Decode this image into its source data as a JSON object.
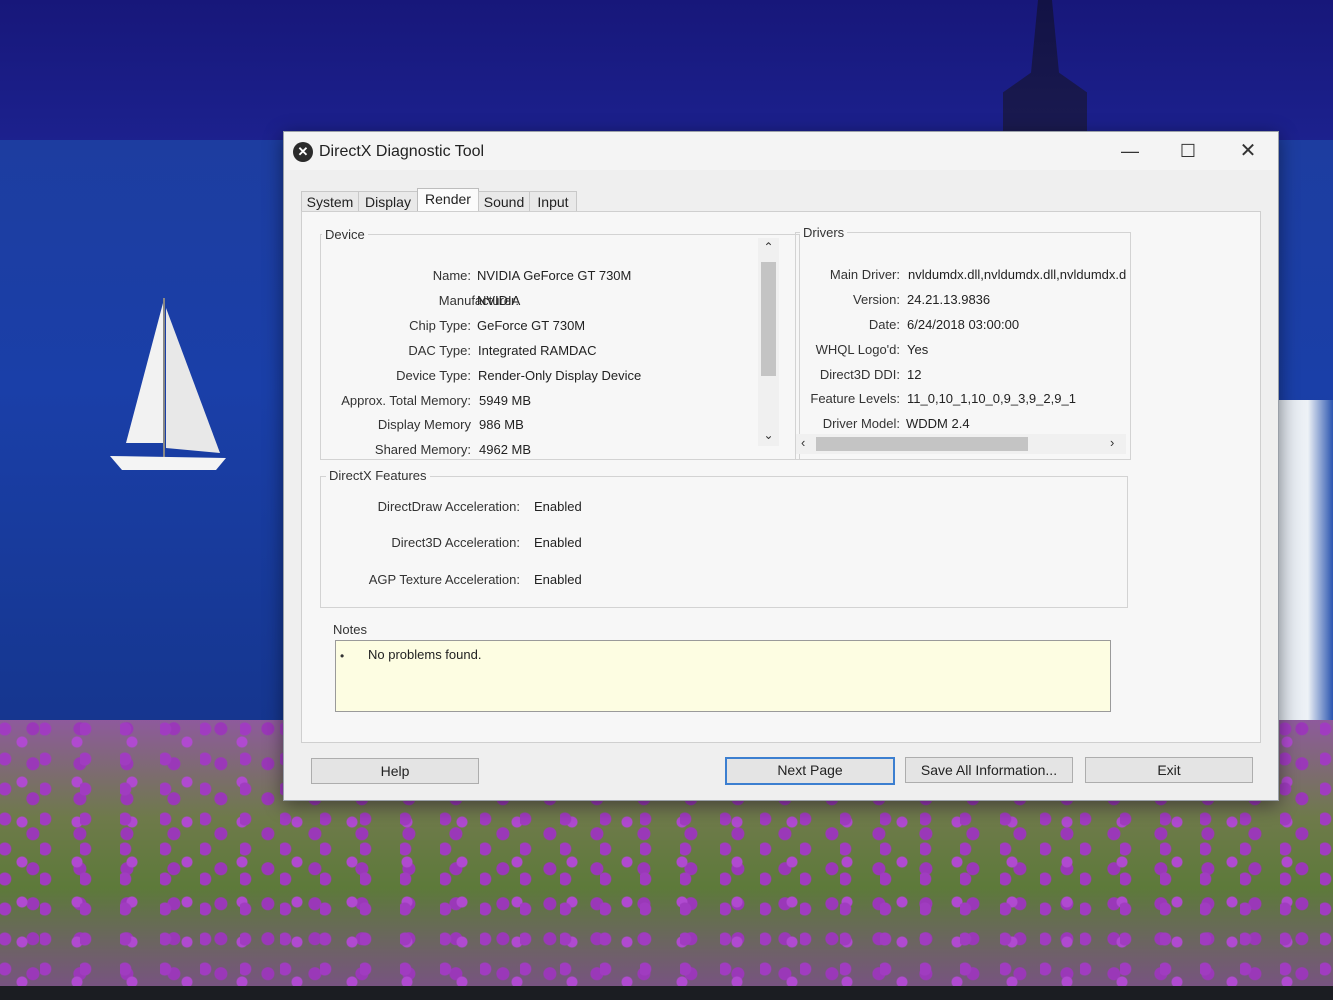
{
  "window": {
    "title": "DirectX Diagnostic Tool",
    "icon": "directx-icon",
    "controls": [
      "minimize-icon",
      "maximize-icon",
      "close-icon"
    ]
  },
  "tabs": [
    {
      "label": "System"
    },
    {
      "label": "Display"
    },
    {
      "label": "Render",
      "active": true
    },
    {
      "label": "Sound"
    },
    {
      "label": "Input"
    }
  ],
  "device": {
    "title": "Device",
    "rows": [
      {
        "label": "Name:",
        "value": "NVIDIA GeForce GT 730M"
      },
      {
        "label": "Manufacturer:",
        "value": "NVIDIA"
      },
      {
        "label": "Chip Type:",
        "value": "GeForce GT 730M"
      },
      {
        "label": "DAC Type:",
        "value": "Integrated RAMDAC"
      },
      {
        "label": "Device Type:",
        "value": "Render-Only Display Device"
      },
      {
        "label": "Approx. Total Memory:",
        "value": "5949 MB"
      },
      {
        "label": "Display Memory",
        "value": "986 MB"
      },
      {
        "label": "Shared Memory:",
        "value": "4962 MB"
      }
    ]
  },
  "drivers": {
    "title": "Drivers",
    "rows": [
      {
        "label": "Main Driver:",
        "value": "nvldumdx.dll,nvldumdx.dll,nvldumdx.d"
      },
      {
        "label": "Version:",
        "value": "24.21.13.9836"
      },
      {
        "label": "Date:",
        "value": "6/24/2018 03:00:00"
      },
      {
        "label": "WHQL Logo'd:",
        "value": "Yes"
      },
      {
        "label": "Direct3D DDI:",
        "value": "12"
      },
      {
        "label": "Feature Levels:",
        "value": "11_0,10_1,10_0,9_3,9_2,9_1"
      },
      {
        "label": "Driver Model:",
        "value": "WDDM 2.4"
      }
    ]
  },
  "features": {
    "title": "DirectX Features",
    "rows": [
      {
        "label": "DirectDraw Acceleration:",
        "value": "Enabled"
      },
      {
        "label": "Direct3D Acceleration:",
        "value": "Enabled"
      },
      {
        "label": "AGP Texture Acceleration:",
        "value": "Enabled"
      }
    ]
  },
  "notes": {
    "title": "Notes",
    "items": [
      "No problems found."
    ]
  },
  "buttons": {
    "help": "Help",
    "next_page": "Next Page",
    "save_all": "Save All Information...",
    "exit": "Exit"
  },
  "colors": {
    "default_button_border": "#3c7fd0",
    "notes_background": "#fdfde2"
  }
}
